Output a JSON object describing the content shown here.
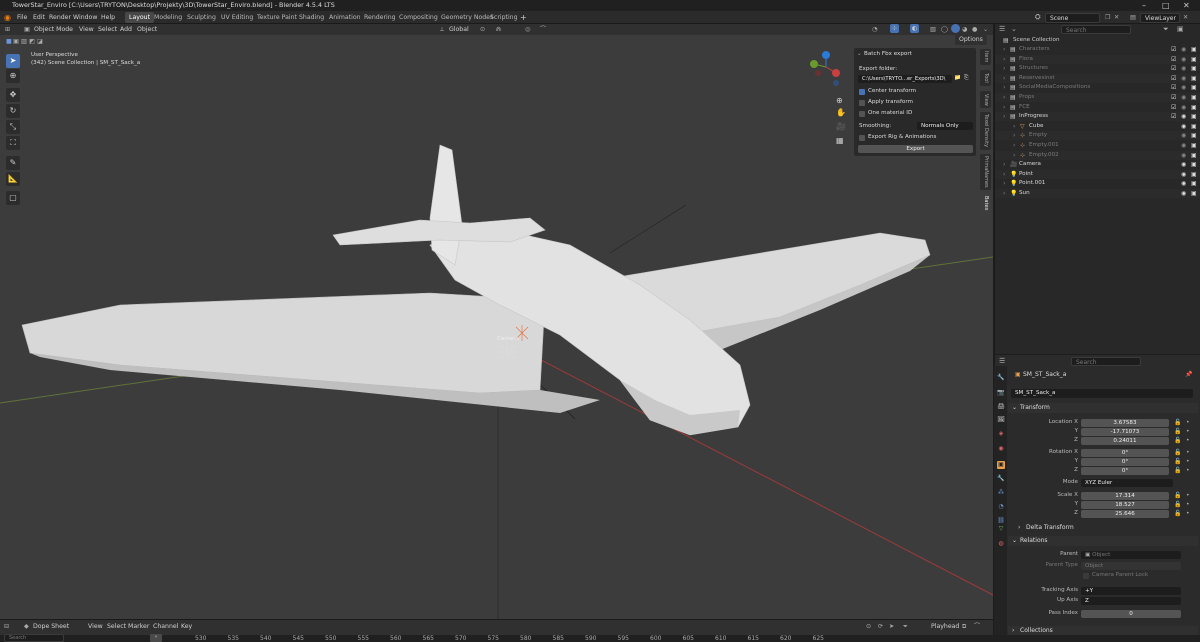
{
  "window": {
    "title": "TowerStar_Enviro [C:\\Users\\TRYTON\\Desktop\\Projekty\\3D\\TowerStar_Enviro.blend] - Blender 4.5.4 LTS"
  },
  "menu": [
    "File",
    "Edit",
    "Render",
    "Window",
    "Help"
  ],
  "workspaces": [
    "Layout",
    "Modeling",
    "Sculpting",
    "UV Editing",
    "Texture Paint",
    "Shading",
    "Animation",
    "Rendering",
    "Compositing",
    "Geometry Nodes",
    "Scripting"
  ],
  "active_workspace": "Layout",
  "add_tab_label": "+",
  "scene_name": "Scene",
  "view_layer": "ViewLayer",
  "viewport": {
    "mode": "Object Mode",
    "header_menus": [
      "View",
      "Select",
      "Add",
      "Object"
    ],
    "orientation": "Global",
    "options_label": "Options",
    "perspective_label": "User Perspective",
    "collection_info": "(342) Scene Collection | SM_ST_Sack_a",
    "camera_label": "Camera"
  },
  "batch_panel": {
    "title": "Batch Fbx export",
    "folder_label": "Export folder:",
    "folder_value": "C:\\Users\\TRYTO...er_Exports\\3D\\",
    "opt_center": "Center transform",
    "opt_apply": "Apply transform",
    "opt_one_material": "One material ID",
    "smoothing_label": "Smoothing:",
    "smoothing_value": "Normals Only",
    "opt_rig": "Export Rig & Animations",
    "export_button": "Export",
    "center_checked": true
  },
  "side_tabs": [
    "Item",
    "Tool",
    "View",
    "Texel Density",
    "PrimaNames",
    "Batex"
  ],
  "outliner": {
    "search_placeholder": "Search",
    "root": "Scene Collection",
    "rows": [
      {
        "label": "Characters",
        "indent": 1,
        "dim": true
      },
      {
        "label": "Flora",
        "indent": 1,
        "dim": true
      },
      {
        "label": "Structures",
        "indent": 1,
        "dim": true
      },
      {
        "label": "Reservesinst",
        "indent": 1,
        "dim": true
      },
      {
        "label": "SocialMediaCompositions",
        "indent": 1,
        "dim": true
      },
      {
        "label": "Props",
        "indent": 1,
        "dim": true
      },
      {
        "label": "FCE",
        "indent": 1,
        "dim": true
      },
      {
        "label": "InProgress",
        "indent": 1,
        "dim": false
      },
      {
        "label": "Cube",
        "indent": 2,
        "dim": false
      },
      {
        "label": "Empty",
        "indent": 2,
        "dim": true
      },
      {
        "label": "Empty.001",
        "indent": 2,
        "dim": true
      },
      {
        "label": "Empty.002",
        "indent": 2,
        "dim": true
      },
      {
        "label": "Camera",
        "indent": 1,
        "dim": false
      },
      {
        "label": "Point",
        "indent": 1,
        "dim": false
      },
      {
        "label": "Point.001",
        "indent": 1,
        "dim": false
      },
      {
        "label": "Sun",
        "indent": 1,
        "dim": false
      }
    ]
  },
  "properties": {
    "search_placeholder": "Search",
    "object_name": "SM_ST_Sack_a",
    "data_name": "SM_ST_Sack_a",
    "transform_title": "Transform",
    "location_label": "Location X",
    "loc_x": "3.67583",
    "loc_y": "-17.71073",
    "loc_z": "0.24011",
    "rotation_label": "Rotation X",
    "rot_x": "0°",
    "rot_y": "0°",
    "rot_z": "0°",
    "mode_label": "Mode",
    "mode_value": "XYZ Euler",
    "scale_label": "Scale X",
    "scale_x": "17.314",
    "scale_y": "18.527",
    "scale_z": "25.646",
    "axis_y": "Y",
    "axis_z": "Z",
    "delta_title": "Delta Transform",
    "relations_title": "Relations",
    "parent_label": "Parent",
    "parent_placeholder": "Object",
    "parent_type_label": "Parent Type",
    "parent_type_value": "Object",
    "camera_parent_lock": "Camera Parent Lock",
    "tracking_axis_label": "Tracking Axis",
    "tracking_axis_value": "+Y",
    "up_axis_label": "Up Axis",
    "up_axis_value": "Z",
    "pass_index_label": "Pass Index",
    "pass_index_value": "0",
    "collections_title": "Collections"
  },
  "timeline": {
    "editor": "Dope Sheet",
    "menus": [
      "View",
      "Select",
      "Marker",
      "Channel",
      "Key"
    ],
    "playhead": "Playhead",
    "frames": [
      "530",
      "535",
      "540",
      "545",
      "550",
      "555",
      "560",
      "565",
      "570",
      "575",
      "580",
      "585",
      "590",
      "595",
      "600",
      "605",
      "610",
      "615",
      "620",
      "625"
    ]
  },
  "status": {
    "search_placeholder": "Search"
  }
}
